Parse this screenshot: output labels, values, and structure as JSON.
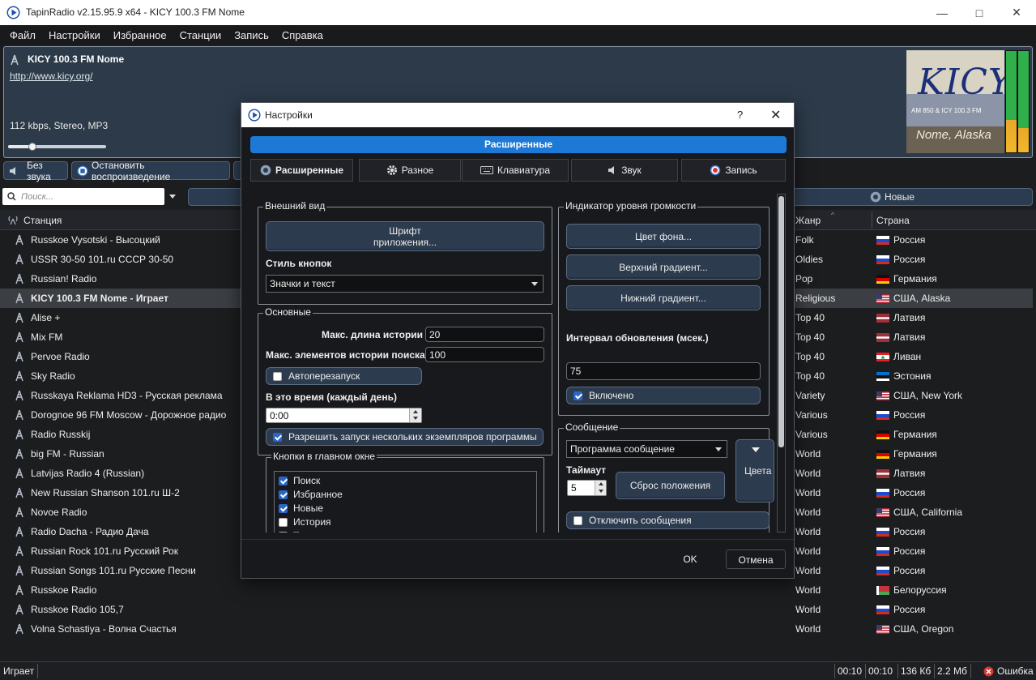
{
  "window": {
    "title": "TapinRadio v2.15.95.9 x64  -  KICY 100.3 FM Nome"
  },
  "menu": [
    "Файл",
    "Настройки",
    "Избранное",
    "Станции",
    "Запись",
    "Справка"
  ],
  "info": {
    "station_name": "KICY 100.3 FM Nome",
    "url": "http://www.kicy.org/",
    "stream_info": "112 kbps, Stereo, MP3",
    "volume_level": 0.25,
    "logo": {
      "line1": "KICY",
      "line2": "AM 850 & ICY 100.3 FM",
      "line3": "Nome, Alaska"
    }
  },
  "toolbar": {
    "mute_label": "Без звука",
    "stop_label": "Остановить воспроизведение",
    "new_label": "Новые"
  },
  "search": {
    "placeholder": "Поиск..."
  },
  "table": {
    "col_station": "Станция",
    "col_genre": "Жанр",
    "col_country": "Страна",
    "rows": [
      {
        "station": "Russkoe Vysotski - Высоцкий",
        "genre": "Folk",
        "country": "Россия",
        "flag": "ru"
      },
      {
        "station": "USSR 30-50 101.ru СССР 30-50",
        "genre": "Oldies",
        "country": "Россия",
        "flag": "ru"
      },
      {
        "station": "Russian! Radio",
        "genre": "Pop",
        "country": "Германия",
        "flag": "de"
      },
      {
        "station": "KICY 100.3 FM Nome - Играет",
        "genre": "Religious",
        "country": "США, Alaska",
        "flag": "us",
        "selected": true
      },
      {
        "station": "Alise +",
        "genre": "Top 40",
        "country": "Латвия",
        "flag": "lv"
      },
      {
        "station": "Mix FM",
        "genre": "Top 40",
        "country": "Латвия",
        "flag": "lv"
      },
      {
        "station": "Pervoe Radio",
        "genre": "Top 40",
        "country": "Ливан",
        "flag": "lb"
      },
      {
        "station": "Sky Radio",
        "genre": "Top 40",
        "country": "Эстония",
        "flag": "ee"
      },
      {
        "station": "Russkaya Reklama HD3 - Русская реклама",
        "genre": "Variety",
        "country": "США, New York",
        "flag": "us"
      },
      {
        "station": "Dorognoe 96 FM Moscow - Дорожное радио",
        "genre": "Various",
        "country": "Россия",
        "flag": "ru"
      },
      {
        "station": "Radio Russkij",
        "genre": "Various",
        "country": "Германия",
        "flag": "de"
      },
      {
        "station": "big FM - Russian",
        "genre": "World",
        "country": "Германия",
        "flag": "de"
      },
      {
        "station": "Latvijas Radio 4 (Russian)",
        "genre": "World",
        "country": "Латвия",
        "flag": "lv"
      },
      {
        "station": "New Russian Shanson 101.ru Ш-2",
        "genre": "World",
        "country": "Россия",
        "flag": "ru"
      },
      {
        "station": "Novoe Radio",
        "genre": "World",
        "country": "США, California",
        "flag": "us"
      },
      {
        "station": "Radio Dacha - Радио Дача",
        "genre": "World",
        "country": "Россия",
        "flag": "ru"
      },
      {
        "station": "Russian Rock 101.ru Русский Рок",
        "genre": "World",
        "country": "Россия",
        "flag": "ru"
      },
      {
        "station": "Russian Songs 101.ru Русские Песни",
        "genre": "World",
        "country": "Россия",
        "flag": "ru"
      },
      {
        "station": "Russkoe Radio",
        "genre": "World",
        "country": "Белоруссия",
        "flag": "by"
      },
      {
        "station": "Russkoe Radio 105,7",
        "genre": "World",
        "country": "Россия",
        "flag": "ru"
      },
      {
        "station": "Volna Schastiya - Волна Счастья",
        "genre": "World",
        "country": "США, Oregon",
        "flag": "us"
      }
    ]
  },
  "status": {
    "state": "Играет",
    "time1": "00:10",
    "time2": "00:10",
    "size1": "136 Кб",
    "size2": "2.2 Мб",
    "error": "Ошибка"
  },
  "dialog": {
    "title": "Настройки",
    "help": "?",
    "banner": "Расширенные",
    "tabs": [
      "Расширенные",
      "Разное",
      "Клавиатура",
      "Звук",
      "Запись"
    ],
    "appearance": {
      "group": "Внешний вид",
      "font_button_line1": "Шрифт",
      "font_button_line2": "приложения...",
      "button_style_label": "Стиль кнопок",
      "button_style_value": "Значки и текст"
    },
    "main": {
      "group": "Основные",
      "history_label": "Макс. длина истории",
      "history_value": "20",
      "search_history_label": "Макс. элементов истории поиска",
      "search_history_value": "100",
      "autorestart_label": "Автоперезапуск",
      "autorestart_checked": false,
      "daily_label": "В это время (каждый день)",
      "daily_value": "0:00",
      "multi_label": "Разрешить запуск нескольких экземпляров программы",
      "multi_checked": true
    },
    "buttons_group": {
      "group": "Кнопки в главном окне",
      "items": [
        {
          "label": "Поиск",
          "checked": true
        },
        {
          "label": "Избранное",
          "checked": true
        },
        {
          "label": "Новые",
          "checked": true
        },
        {
          "label": "История",
          "checked": false
        },
        {
          "label": "Т",
          "checked": false
        }
      ]
    },
    "volume": {
      "group": "Индикатор уровня громкости",
      "bg_button": "Цвет фона...",
      "top_gradient": "Верхний градиент...",
      "bottom_gradient": "Нижний градиент...",
      "interval_label": "Интервал обновления (мсек.)",
      "interval_value": "75",
      "enabled_label": "Включено",
      "enabled_checked": true
    },
    "message": {
      "group": "Сообщение",
      "program_value": "Программа сообщение",
      "timeout_label": "Таймаут",
      "timeout_value": "5",
      "reset_button": "Сброс положения",
      "colors_button": "Цвета",
      "disable_label": "Отключить сообщения",
      "disable_checked": false
    },
    "ok": "OK",
    "cancel": "Отмена"
  }
}
